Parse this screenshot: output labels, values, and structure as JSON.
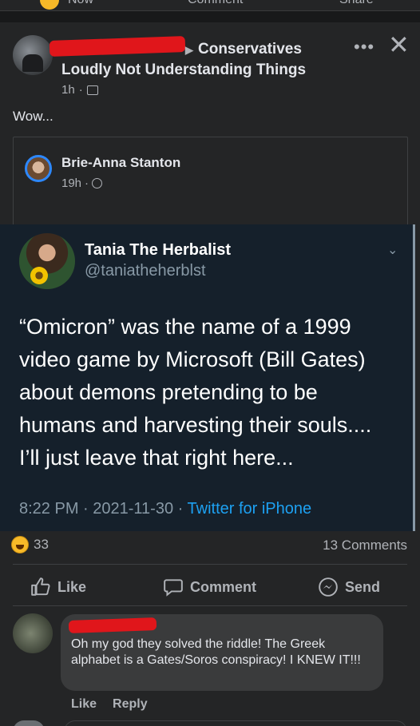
{
  "top_bar": {
    "cut_labels": [
      "Now",
      "Comment",
      "Share"
    ]
  },
  "post": {
    "group": "Conservatives",
    "group_line2": "Loudly Not Understanding Things",
    "time": "1h",
    "text": "Wow...",
    "menu_label": "•••",
    "close_label": "✕"
  },
  "shared": {
    "author": "Brie-Anna Stanton",
    "time": "19h"
  },
  "tweet": {
    "name": "Tania The Herbalist",
    "handle": "@taniatheherblst",
    "lines": [
      "“Omicron” was the name of a 1999",
      "video game by Microsoft (Bill Gates)",
      "about demons pretending to be",
      "humans and harvesting their souls....",
      "I’ll just leave that right here..."
    ],
    "time": "8:22 PM",
    "date": "2021-11-30",
    "source": "Twitter for iPhone"
  },
  "stats": {
    "reactions": "33",
    "comments": "13 Comments"
  },
  "actions": {
    "like": "Like",
    "comment": "Comment",
    "send": "Send"
  },
  "comment": {
    "text": "Oh my god they solved the riddle! The Greek alphabet is a Gates/Soros conspiracy! I KNEW IT!!!",
    "like": "Like",
    "reply": "Reply"
  },
  "colors": {
    "background": "#18191a",
    "card": "#242526",
    "tweet_bg": "#15202b",
    "link_blue": "#1da1f2",
    "redaction": "#e0161b"
  }
}
